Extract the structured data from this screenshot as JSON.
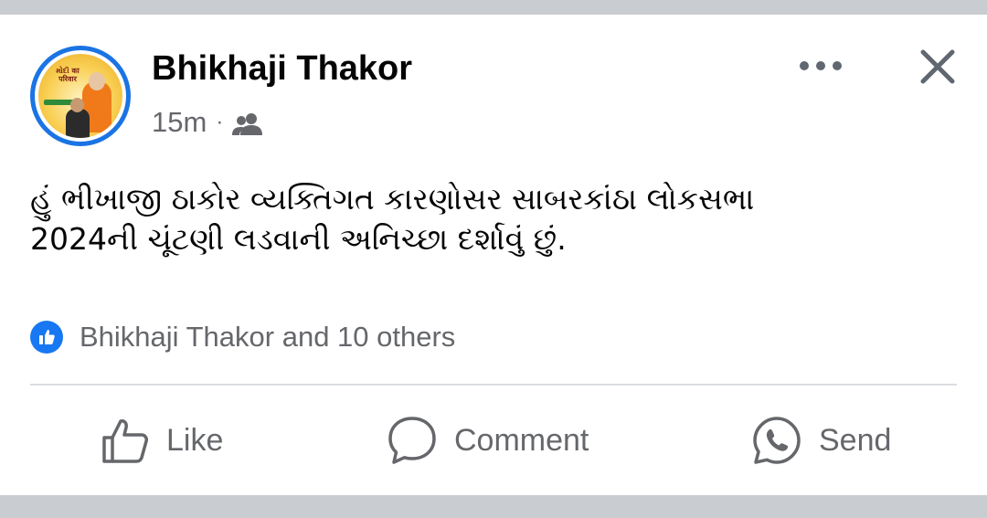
{
  "post": {
    "author": "Bhikhaji Thakor",
    "time": "15m",
    "separator": "·",
    "audience_icon": "friends-icon",
    "text_line1": "હું ભીખાજી ઠાકોર વ્યક્તિગત કારણોસર સાબરકાંઠા લોકસભા",
    "text_line2": "2024ની ચૂંટણી લડવાની અનિચ્છા દર્શાવું છું.",
    "reactions_text": "Bhikhaji Thakor and 10 others",
    "avatar_text": "મોદી का परिवार"
  },
  "actions": {
    "like": "Like",
    "comment": "Comment",
    "send": "Send"
  },
  "colors": {
    "accent": "#1877f2",
    "avatar_ring": "#1b74e4",
    "secondary_text": "#65676b",
    "background": "#c9ccd1"
  }
}
